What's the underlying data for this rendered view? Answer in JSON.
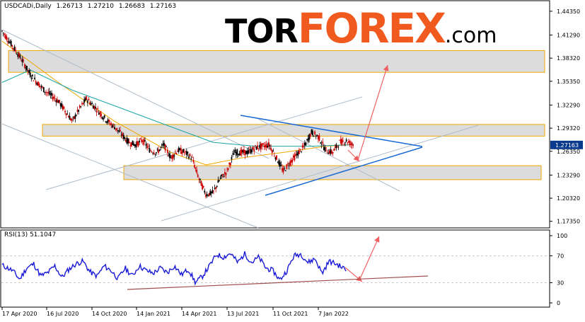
{
  "chart_data": {
    "type": "candlestick",
    "header": {
      "symbol": "USDCADi,Daily",
      "open": "1.26713",
      "high": "1.27210",
      "low": "1.26683",
      "close": "1.27163"
    },
    "price_ticks": [
      "1.44350",
      "1.41290",
      "1.38320",
      "1.35350",
      "1.32290",
      "1.29320",
      "1.26350",
      "1.23290",
      "1.20320",
      "1.17350"
    ],
    "current_price": "1.27163",
    "x_labels": [
      "17 Apr 2020",
      "16 Jul 2020",
      "14 Oct 2020",
      "14 Jan 2021",
      "14 Apr 2021",
      "13 Jul 2021",
      "11 Oct 2021",
      "7 Jan 2022"
    ],
    "ylim": [
      1.1705,
      1.4525
    ],
    "price_path": [
      [
        0,
        1.418
      ],
      [
        10,
        1.405
      ],
      [
        20,
        1.392
      ],
      [
        30,
        1.378
      ],
      [
        40,
        1.362
      ],
      [
        50,
        1.352
      ],
      [
        60,
        1.342
      ],
      [
        70,
        1.335
      ],
      [
        80,
        1.328
      ],
      [
        90,
        1.315
      ],
      [
        100,
        1.302
      ],
      [
        110,
        1.318
      ],
      [
        120,
        1.331
      ],
      [
        130,
        1.322
      ],
      [
        140,
        1.312
      ],
      [
        150,
        1.302
      ],
      [
        160,
        1.295
      ],
      [
        170,
        1.285
      ],
      [
        180,
        1.275
      ],
      [
        190,
        1.272
      ],
      [
        200,
        1.278
      ],
      [
        210,
        1.265
      ],
      [
        220,
        1.262
      ],
      [
        230,
        1.272
      ],
      [
        240,
        1.255
      ],
      [
        250,
        1.265
      ],
      [
        260,
        1.262
      ],
      [
        270,
        1.255
      ],
      [
        280,
        1.228
      ],
      [
        290,
        1.208
      ],
      [
        300,
        1.21
      ],
      [
        310,
        1.228
      ],
      [
        320,
        1.238
      ],
      [
        330,
        1.262
      ],
      [
        340,
        1.262
      ],
      [
        350,
        1.262
      ],
      [
        360,
        1.268
      ],
      [
        370,
        1.27
      ],
      [
        380,
        1.272
      ],
      [
        390,
        1.255
      ],
      [
        400,
        1.238
      ],
      [
        410,
        1.25
      ],
      [
        420,
        1.26
      ],
      [
        430,
        1.27
      ],
      [
        440,
        1.288
      ],
      [
        450,
        1.282
      ],
      [
        460,
        1.265
      ],
      [
        470,
        1.262
      ],
      [
        480,
        1.275
      ],
      [
        490,
        1.277
      ],
      [
        500,
        1.271
      ]
    ],
    "series": [
      {
        "name": "",
        "color": "#f0a800",
        "values": [
          [
            0,
            1.405
          ],
          [
            80,
            1.352
          ],
          [
            160,
            1.302
          ],
          [
            240,
            1.262
          ],
          [
            290,
            1.246
          ],
          [
            340,
            1.255
          ],
          [
            400,
            1.262
          ],
          [
            460,
            1.27
          ],
          [
            500,
            1.272
          ]
        ]
      },
      {
        "name": "",
        "color": "#1aa5a5",
        "values": [
          [
            0,
            1.352
          ],
          [
            40,
            1.368
          ],
          [
            100,
            1.342
          ],
          [
            160,
            1.322
          ],
          [
            240,
            1.295
          ],
          [
            300,
            1.275
          ],
          [
            360,
            1.27
          ],
          [
            440,
            1.27
          ],
          [
            500,
            1.272
          ]
        ]
      }
    ],
    "zones": [
      {
        "x0": 12,
        "x1": 770,
        "y_top": 1.393,
        "y_bottom": 1.365
      },
      {
        "x0": 60,
        "x1": 770,
        "y_top": 1.298,
        "y_bottom": 1.283
      },
      {
        "x0": 175,
        "x1": 765,
        "y_top": 1.245,
        "y_bottom": 1.227
      }
    ],
    "colors": {
      "zone_fill": "#dcdcdc",
      "zone_border": "#f0a800",
      "candle_up": "#000000",
      "candle_down": "#cc0000",
      "channel": "#b0bcc8",
      "trend": "#1a6ad6",
      "arrow": "#f06060",
      "rsi_line": "#1a1ad6",
      "rsi_trend": "#a05050",
      "price_label_bg": "#0a3a8c"
    },
    "rsi": {
      "label": "RSI(13) 51.1047",
      "ticks": [
        "100",
        "70",
        "30",
        "0"
      ],
      "levels": [
        100,
        70,
        30,
        0
      ],
      "path": [
        [
          0,
          56
        ],
        [
          15,
          48
        ],
        [
          25,
          35
        ],
        [
          35,
          52
        ],
        [
          45,
          58
        ],
        [
          55,
          40
        ],
        [
          65,
          45
        ],
        [
          75,
          55
        ],
        [
          85,
          38
        ],
        [
          95,
          50
        ],
        [
          105,
          58
        ],
        [
          115,
          62
        ],
        [
          125,
          46
        ],
        [
          135,
          40
        ],
        [
          145,
          55
        ],
        [
          155,
          48
        ],
        [
          165,
          36
        ],
        [
          175,
          52
        ],
        [
          185,
          40
        ],
        [
          195,
          55
        ],
        [
          205,
          48
        ],
        [
          215,
          44
        ],
        [
          225,
          52
        ],
        [
          235,
          45
        ],
        [
          245,
          55
        ],
        [
          255,
          42
        ],
        [
          265,
          50
        ],
        [
          275,
          30
        ],
        [
          285,
          40
        ],
        [
          295,
          55
        ],
        [
          305,
          72
        ],
        [
          315,
          68
        ],
        [
          325,
          74
        ],
        [
          335,
          60
        ],
        [
          345,
          73
        ],
        [
          355,
          60
        ],
        [
          365,
          68
        ],
        [
          375,
          52
        ],
        [
          385,
          48
        ],
        [
          395,
          34
        ],
        [
          405,
          48
        ],
        [
          415,
          70
        ],
        [
          425,
          73
        ],
        [
          435,
          60
        ],
        [
          445,
          66
        ],
        [
          455,
          44
        ],
        [
          465,
          62
        ],
        [
          475,
          58
        ],
        [
          485,
          52
        ],
        [
          490,
          48
        ]
      ],
      "trend": [
        [
          180,
          20
        ],
        [
          605,
          40
        ]
      ]
    }
  },
  "logo": {
    "part1": "TOR",
    "part2": "FOREX",
    "part3": ".com"
  }
}
